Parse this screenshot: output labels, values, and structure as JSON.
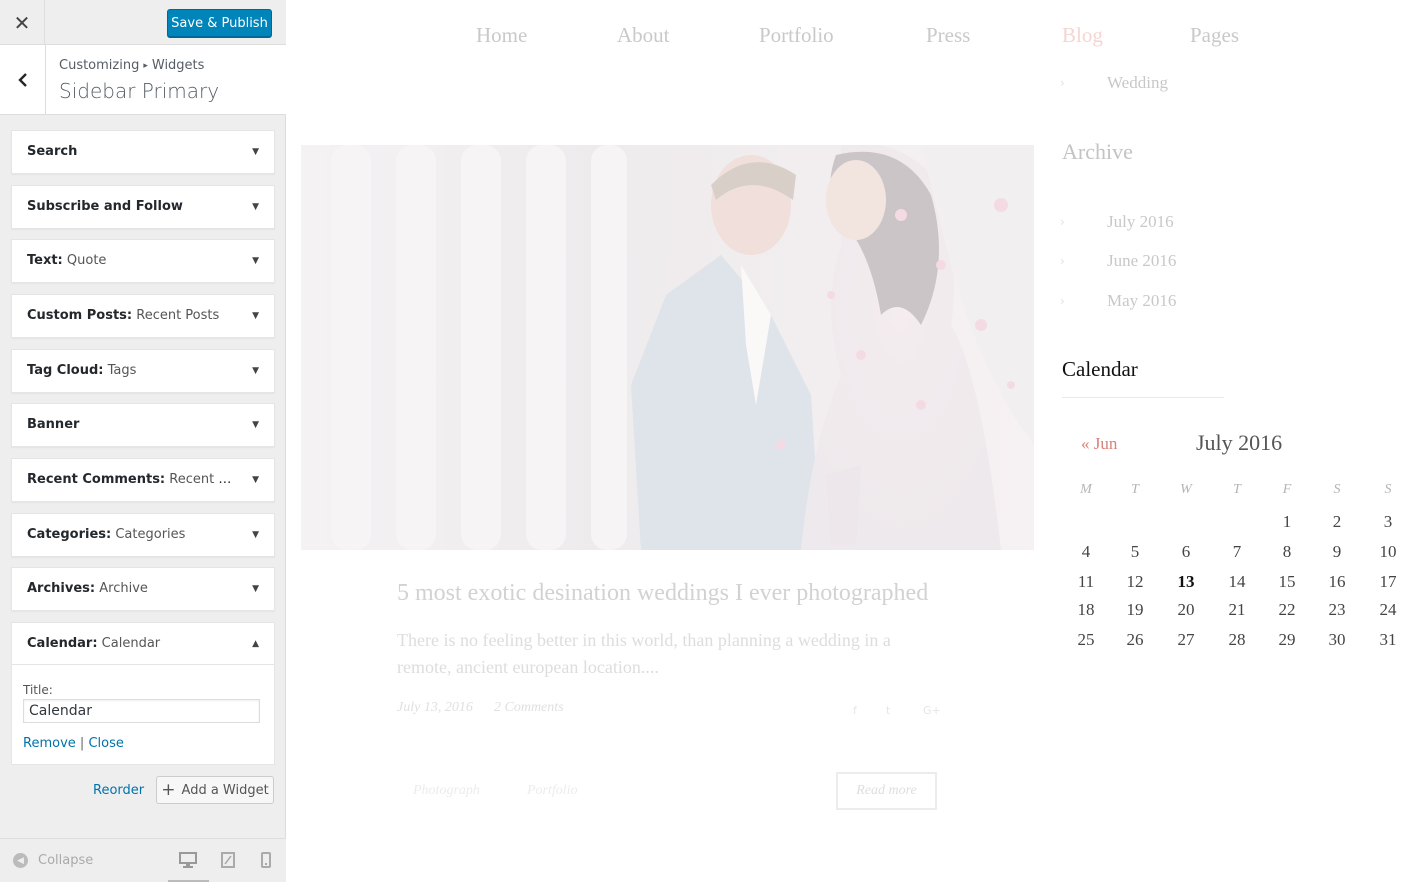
{
  "customizer": {
    "close_icon": "close-icon",
    "save_label": "Save & Publish",
    "back_icon": "chevron-left-icon",
    "breadcrumb": [
      "Customizing",
      "Widgets"
    ],
    "section_title": "Sidebar Primary",
    "widgets": [
      {
        "type": "Search",
        "title": ""
      },
      {
        "type": "Subscribe and Follow",
        "title": ""
      },
      {
        "type": "Text:",
        "title": "Quote"
      },
      {
        "type": "Custom Posts:",
        "title": "Recent Posts"
      },
      {
        "type": "Tag Cloud:",
        "title": "Tags"
      },
      {
        "type": "Banner",
        "title": ""
      },
      {
        "type": "Recent Comments:",
        "title": "Recent Com..."
      },
      {
        "type": "Categories:",
        "title": "Categories"
      },
      {
        "type": "Archives:",
        "title": "Archive"
      }
    ],
    "expanded_widget": {
      "type": "Calendar:",
      "title": "Calendar",
      "field_label": "Title:",
      "field_value": "Calendar",
      "remove_label": "Remove",
      "separator": "|",
      "close_label": "Close"
    },
    "reorder_label": "Reorder",
    "add_widget_label": "Add a Widget",
    "collapse_label": "Collapse",
    "devices": [
      "desktop-icon",
      "tablet-icon",
      "mobile-icon"
    ]
  },
  "preview": {
    "nav": [
      "Home",
      "About",
      "Portfolio",
      "Press",
      "Blog",
      "Pages"
    ],
    "active_nav": "Blog",
    "category_link": "Wedding",
    "post": {
      "title": "5 most exotic desination weddings I ever photographed",
      "excerpt": "There is no feeling better in this world, than planning a wedding in a remote, ancient european location....",
      "date": "July 13, 2016",
      "comments": "2 Comments",
      "social": [
        "f",
        "t",
        "G+"
      ],
      "tags": [
        "Photograph",
        "Portfolio"
      ],
      "read_more": "Read more"
    },
    "archive": {
      "title": "Archive",
      "items": [
        "July 2016",
        "June 2016",
        "May 2016"
      ]
    },
    "calendar": {
      "heading": "Calendar",
      "prev": "« Jun",
      "month": "July 2016",
      "weekdays": [
        "M",
        "T",
        "W",
        "T",
        "F",
        "S",
        "S"
      ],
      "first_weekday_index": 4,
      "days_in_month": 31,
      "today": 13
    },
    "colors": {
      "accent": "#d9807a",
      "save_button": "#0085ba",
      "link": "#0073aa"
    }
  }
}
